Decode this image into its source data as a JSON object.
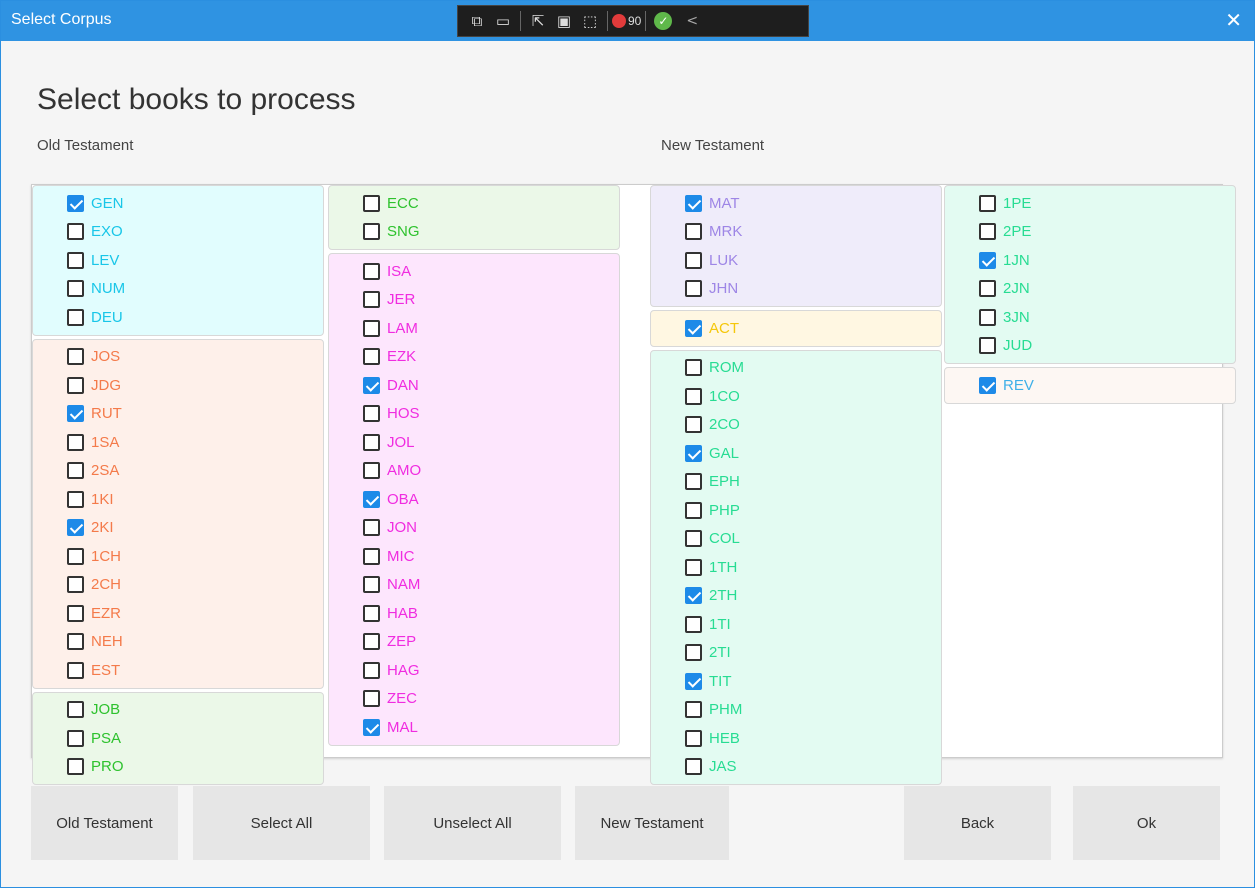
{
  "window": {
    "title": "Select Corpus",
    "close": "✕"
  },
  "debug_toolbar": {
    "count": "90"
  },
  "heading": "Select books to process",
  "labels": {
    "old": "Old Testament",
    "new": "New Testament"
  },
  "groups": [
    {
      "column": 0,
      "bg": "#e1fdfe",
      "color": "#18c6e8",
      "books": [
        {
          "code": "GEN",
          "checked": true
        },
        {
          "code": "EXO",
          "checked": false
        },
        {
          "code": "LEV",
          "checked": false
        },
        {
          "code": "NUM",
          "checked": false
        },
        {
          "code": "DEU",
          "checked": false
        }
      ]
    },
    {
      "column": 0,
      "bg": "#fef0ea",
      "color": "#f47a4a",
      "books": [
        {
          "code": "JOS",
          "checked": false
        },
        {
          "code": "JDG",
          "checked": false
        },
        {
          "code": "RUT",
          "checked": true
        },
        {
          "code": "1SA",
          "checked": false
        },
        {
          "code": "2SA",
          "checked": false
        },
        {
          "code": "1KI",
          "checked": false
        },
        {
          "code": "2KI",
          "checked": true
        },
        {
          "code": "1CH",
          "checked": false
        },
        {
          "code": "2CH",
          "checked": false
        },
        {
          "code": "EZR",
          "checked": false
        },
        {
          "code": "NEH",
          "checked": false
        },
        {
          "code": "EST",
          "checked": false
        }
      ]
    },
    {
      "column": 0,
      "bg": "#ebf8e8",
      "color": "#2ec22e",
      "books": [
        {
          "code": "JOB",
          "checked": false
        },
        {
          "code": "PSA",
          "checked": false
        },
        {
          "code": "PRO",
          "checked": false
        }
      ]
    },
    {
      "column": 1,
      "bg": "#ebf8e8",
      "color": "#2ec22e",
      "books": [
        {
          "code": "ECC",
          "checked": false
        },
        {
          "code": "SNG",
          "checked": false
        }
      ]
    },
    {
      "column": 1,
      "bg": "#fde6fd",
      "color": "#f02ce0",
      "books": [
        {
          "code": "ISA",
          "checked": false
        },
        {
          "code": "JER",
          "checked": false
        },
        {
          "code": "LAM",
          "checked": false
        },
        {
          "code": "EZK",
          "checked": false
        },
        {
          "code": "DAN",
          "checked": true
        },
        {
          "code": "HOS",
          "checked": false
        },
        {
          "code": "JOL",
          "checked": false
        },
        {
          "code": "AMO",
          "checked": false
        },
        {
          "code": "OBA",
          "checked": true
        },
        {
          "code": "JON",
          "checked": false
        },
        {
          "code": "MIC",
          "checked": false
        },
        {
          "code": "NAM",
          "checked": false
        },
        {
          "code": "HAB",
          "checked": false
        },
        {
          "code": "ZEP",
          "checked": false
        },
        {
          "code": "HAG",
          "checked": false
        },
        {
          "code": "ZEC",
          "checked": false
        },
        {
          "code": "MAL",
          "checked": true
        }
      ]
    },
    {
      "column": 2,
      "bg": "#efecfa",
      "color": "#9e86e6",
      "books": [
        {
          "code": "MAT",
          "checked": true
        },
        {
          "code": "MRK",
          "checked": false
        },
        {
          "code": "LUK",
          "checked": false
        },
        {
          "code": "JHN",
          "checked": false
        }
      ]
    },
    {
      "column": 2,
      "bg": "#fff7e2",
      "color": "#f5c70a",
      "books": [
        {
          "code": "ACT",
          "checked": true
        }
      ]
    },
    {
      "column": 2,
      "bg": "#e3fbf2",
      "color": "#27dc93",
      "books": [
        {
          "code": "ROM",
          "checked": false
        },
        {
          "code": "1CO",
          "checked": false
        },
        {
          "code": "2CO",
          "checked": false
        },
        {
          "code": "GAL",
          "checked": true
        },
        {
          "code": "EPH",
          "checked": false
        },
        {
          "code": "PHP",
          "checked": false
        },
        {
          "code": "COL",
          "checked": false
        },
        {
          "code": "1TH",
          "checked": false
        },
        {
          "code": "2TH",
          "checked": true
        },
        {
          "code": "1TI",
          "checked": false
        },
        {
          "code": "2TI",
          "checked": false
        },
        {
          "code": "TIT",
          "checked": true
        },
        {
          "code": "PHM",
          "checked": false
        },
        {
          "code": "HEB",
          "checked": false
        },
        {
          "code": "JAS",
          "checked": false
        }
      ]
    },
    {
      "column": 3,
      "bg": "#e3fbf2",
      "color": "#27dc93",
      "books": [
        {
          "code": "1PE",
          "checked": false
        },
        {
          "code": "2PE",
          "checked": false
        },
        {
          "code": "1JN",
          "checked": true
        },
        {
          "code": "2JN",
          "checked": false
        },
        {
          "code": "3JN",
          "checked": false
        },
        {
          "code": "JUD",
          "checked": false
        }
      ]
    },
    {
      "column": 3,
      "bg": "#fdf7f3",
      "color": "#3fb0e8",
      "books": [
        {
          "code": "REV",
          "checked": true
        }
      ]
    }
  ],
  "buttons": {
    "old_testament": "Old Testament",
    "select_all": "Select All",
    "unselect_all": "Unselect All",
    "new_testament": "New Testament",
    "back": "Back",
    "ok": "Ok"
  }
}
